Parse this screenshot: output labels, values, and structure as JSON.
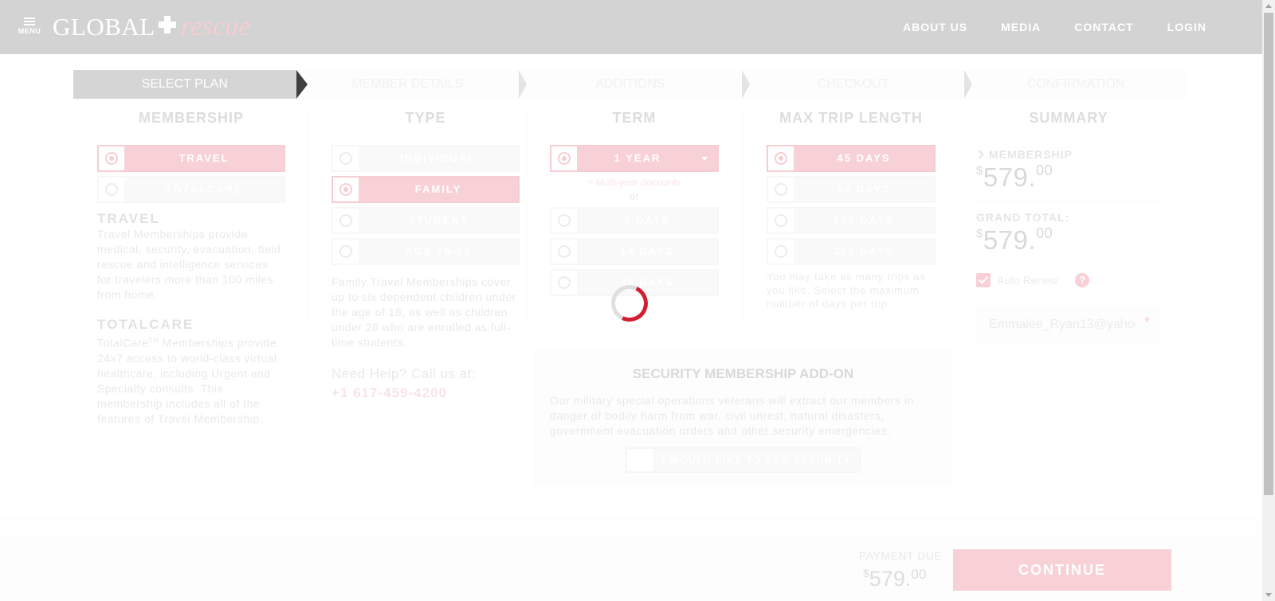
{
  "header": {
    "menu_label": "MENU",
    "logo_word1": "GLOBAL",
    "logo_word2": "rescue",
    "nav": [
      "ABOUT US",
      "MEDIA",
      "CONTACT",
      "LOGIN"
    ]
  },
  "steps": [
    "SELECT PLAN",
    "MEMBER DETAILS",
    "ADDITIONS",
    "CHECKOUT",
    "CONFIRMATION"
  ],
  "active_step": 0,
  "membership": {
    "heading": "MEMBERSHIP",
    "options": [
      "TRAVEL",
      "TOTALCARE"
    ],
    "selected": "TRAVEL",
    "travel_title": "TRAVEL",
    "travel_desc": "Travel Memberships provide medical, security, evacuation, field rescue and intelligence services for travelers more than 100 miles from home.",
    "totalcare_title": "TOTALCARE",
    "totalcare_desc_brand": "TotalCare",
    "totalcare_desc_mark": "SM",
    "totalcare_desc": " Memberships provide 24x7 access to world-class virtual healthcare, including Urgent and Specialty consults. This membership includes all of the features of Travel Membership."
  },
  "type": {
    "heading": "TYPE",
    "options": [
      "INDIVIDUAL",
      "FAMILY",
      "STUDENT",
      "AGE 75-85"
    ],
    "selected": "FAMILY",
    "desc": "Family Travel Memberships cover up to six dependent children under the age of 18, as well as children under 26 who are enrolled as full-time students.",
    "help_label": "Need Help? Call us at:",
    "help_phone": "+1 617-459-4200"
  },
  "term": {
    "heading": "TERM",
    "select_value": "1 YEAR",
    "multi_year": "+ Multi-year discounts",
    "or": "or",
    "options": [
      "7 DAYS",
      "14 DAYS",
      "30 DAYS"
    ]
  },
  "max_trip": {
    "heading": "MAX TRIP LENGTH",
    "options": [
      "45 DAYS",
      "90 DAYS",
      "180 DAYS",
      "365 DAYS"
    ],
    "selected": "45 DAYS",
    "note": "You may take as many trips as you like. Select the maximum number of days per trip."
  },
  "addon": {
    "title": "SECURITY MEMBERSHIP ADD-ON",
    "desc": "Our military special operations veterans will extract our members in danger of bodily harm from war, civil unrest, natural disasters, government evacuation orders and other security emergencies.",
    "button": "I WOULD LIKE TO ADD SECURITY"
  },
  "summary": {
    "heading": "SUMMARY",
    "membership_label": "MEMBERSHIP",
    "membership_currency": "$",
    "membership_amount": "579.",
    "membership_cents": "00",
    "grand_total_label": "GRAND TOTAL:",
    "grand_total_currency": "$",
    "grand_total_amount": "579.",
    "grand_total_cents": "00",
    "auto_renew_label": "Auto Renew",
    "auto_renew_checked": true,
    "help_icon": "?",
    "email_value": "Emmalee_Ryan13@yahoo.com",
    "required_mark": "*"
  },
  "footer": {
    "payment_due_label": "PAYMENT DUE",
    "currency": "$",
    "amount": "579.",
    "cents": "00",
    "continue_label": "CONTINUE"
  },
  "colors": {
    "accent": "#d21f32",
    "header_bg": "#3a3a3a"
  }
}
